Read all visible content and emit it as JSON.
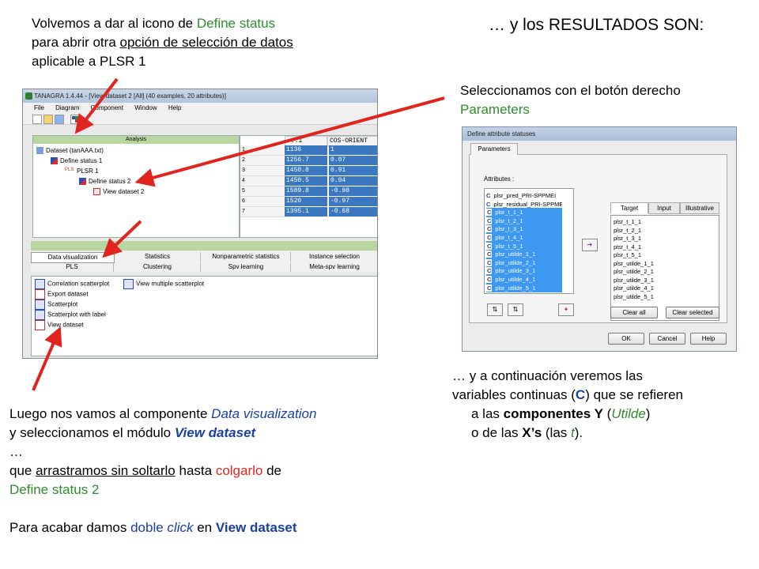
{
  "heading_right": "… y los RESULTADOS SON:",
  "top_left": {
    "p1": "Volvemos a dar al icono de ",
    "p2": "Define status",
    "p3": "para abrir otra ",
    "p4": "opción de selección de datos",
    "p5": "aplicable a PLSR 1"
  },
  "top_right_note": {
    "p1": "Seleccionamos con el botón derecho",
    "p2": "Parameters"
  },
  "bottom_left": {
    "p1": "Luego nos vamos al componente ",
    "p2": "Data visualization",
    "p3": "y seleccionamos el módulo ",
    "p4": "View dataset",
    "p5": "…",
    "p6": "que ",
    "p7": "arrastramos sin soltarlo",
    "p8": " hasta ",
    "p9": "colgarlo",
    "p10": " de",
    "p11": "Define status 2",
    "p12": "Para acabar damos ",
    "p13": "doble ",
    "p14": "click",
    "p15": " en ",
    "p16": "View dataset"
  },
  "bottom_right": {
    "p1": "… y a continuación veremos las",
    "p2": "variables continuas (",
    "p3": "C",
    "p4": ") que se refieren",
    "p5": "a las ",
    "p6": "componentes Y",
    "p7": " (",
    "p8": "Utilde",
    "p9": ")",
    "p10": "o de las ",
    "p11": "X’s",
    "p12": " (las ",
    "p13": "t",
    "p14": ")."
  },
  "tanagra": {
    "title": "TANAGRA 1.4.44 - [View dataset 2 [All] (40 examples, 20 attributes)]",
    "menu": [
      "File",
      "Diagram",
      "Component",
      "Window",
      "Help"
    ],
    "tree_header": "Analysis",
    "tree": [
      "Dataset (tanAAA.txt)",
      "Define status 1",
      "PLSR 1",
      "Define status 2",
      "View dataset 2"
    ],
    "pls_icon": "PLS",
    "grid_headers": [
      "...1",
      "COS-ORIENT"
    ],
    "grid_rows": [
      {
        "n": "1",
        "a": "1136",
        "b": "1"
      },
      {
        "n": "2",
        "a": "1256.7",
        "b": "0.07"
      },
      {
        "n": "3",
        "a": "1450.8",
        "b": "0.91"
      },
      {
        "n": "4",
        "a": "1450.5",
        "b": "0.04"
      },
      {
        "n": "5",
        "a": "1589.8",
        "b": "-0.98"
      },
      {
        "n": "6",
        "a": "1520",
        "b": "-0.97"
      },
      {
        "n": "7",
        "a": "1395.1",
        "b": "-0.68"
      }
    ],
    "tabs_row1": [
      "Data visualization",
      "Statistics",
      "Nonparametric statistics",
      "Instance selection"
    ],
    "tabs_row2": [
      "PLS",
      "Clustering",
      "Spv learning",
      "Meta-spv learning"
    ],
    "components": [
      "Correlation scatterplot",
      "View multiple scatterplot",
      "Export dataset",
      "Scatterplot",
      "Scatterplot with label",
      "View dataset"
    ]
  },
  "dialog": {
    "title": "Define attribute statuses",
    "tab": "Parameters",
    "attributes_label": "Attributes :",
    "attributes": [
      {
        "t": "plsr_pred_PRI-SPPMEI",
        "sel": false
      },
      {
        "t": "plsr_residual_PRI-SPPMEI",
        "sel": false
      },
      {
        "t": "plsr_t_1_1",
        "sel": true
      },
      {
        "t": "plsr_t_2_1",
        "sel": true
      },
      {
        "t": "plsr_t_3_1",
        "sel": true
      },
      {
        "t": "plsr_t_4_1",
        "sel": true
      },
      {
        "t": "plsr_t_5_1",
        "sel": true
      },
      {
        "t": "plsr_utilde_1_1",
        "sel": true
      },
      {
        "t": "plsr_utilde_2_1",
        "sel": true
      },
      {
        "t": "plsr_utilde_3_1",
        "sel": true
      },
      {
        "t": "plsr_utilde_4_1",
        "sel": true
      },
      {
        "t": "plsr_utilde_5_1",
        "sel": true
      }
    ],
    "attr_prefix": "C",
    "right_tabs": [
      "Target",
      "Input",
      "Illustrative"
    ],
    "targets": [
      "plsr_t_1_1",
      "plsr_t_2_1",
      "plsr_t_3_1",
      "plsr_t_4_1",
      "plsr_t_5_1",
      "plsr_utilde_1_1",
      "plsr_utilde_2_1",
      "plsr_utilde_3_1",
      "plsr_utilde_4_1",
      "plsr_utilde_5_1"
    ],
    "clear_all": "Clear all",
    "clear_selected": "Clear selected",
    "ok": "OK",
    "cancel": "Cancel",
    "help": "Help"
  },
  "colors": {
    "green": "#2e8b2e",
    "blue": "#1a3fa6",
    "red": "#e0251f",
    "selection": "#3c98f0"
  }
}
